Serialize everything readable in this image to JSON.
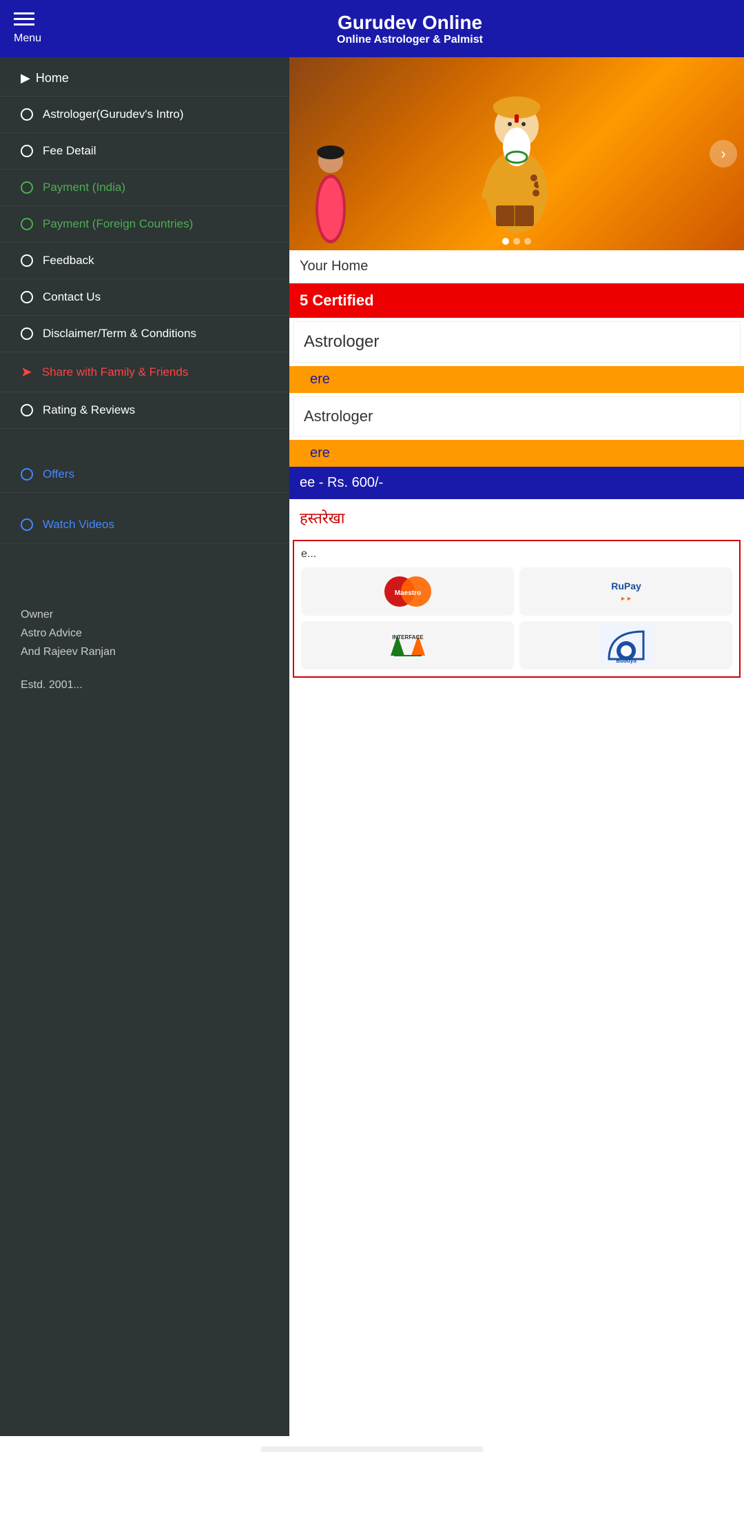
{
  "header": {
    "menu_label": "Menu",
    "app_title": "Gurudev Online",
    "app_subtitle": "Online Astrologer & Palmist"
  },
  "sidebar": {
    "home_label": "Home",
    "items": [
      {
        "id": "astrologer-intro",
        "label": "Astrologer(Gurudev's Intro)",
        "icon": "circle",
        "color": "white"
      },
      {
        "id": "fee-detail",
        "label": "Fee Detail",
        "icon": "circle",
        "color": "white"
      },
      {
        "id": "payment-india",
        "label": "Payment (India)",
        "icon": "circle-green",
        "color": "green"
      },
      {
        "id": "payment-foreign",
        "label": "Payment (Foreign Countries)",
        "icon": "circle-green",
        "color": "green"
      },
      {
        "id": "feedback",
        "label": "Feedback",
        "icon": "circle",
        "color": "white"
      },
      {
        "id": "contact-us",
        "label": "Contact Us",
        "icon": "circle",
        "color": "white"
      },
      {
        "id": "disclaimer",
        "label": "Disclaimer/Term & Conditions",
        "icon": "circle",
        "color": "white"
      },
      {
        "id": "share",
        "label": "Share with Family & Friends",
        "icon": "arrow",
        "color": "red"
      },
      {
        "id": "rating",
        "label": "Rating & Reviews",
        "icon": "circle",
        "color": "white"
      },
      {
        "id": "offers",
        "label": "Offers",
        "icon": "circle-blue",
        "color": "blue"
      },
      {
        "id": "watch-videos",
        "label": "Watch Videos",
        "icon": "circle-blue",
        "color": "blue"
      }
    ],
    "footer": {
      "owner_label": "Owner",
      "owner_name1": "Astro Advice",
      "owner_name2": "And Rajeev Ranjan",
      "estd": "Estd. 2001..."
    }
  },
  "main": {
    "hero_dots": [
      "active",
      "inactive",
      "inactive"
    ],
    "your_home": "Your Home",
    "certified_banner": "5 Certified",
    "astrologer_card1": {
      "title": "Astrologer"
    },
    "visit_here1": "ere",
    "astrologer_card2": {
      "title": "Astrologer"
    },
    "visit_here2": "ere",
    "fee_banner": "ee - Rs. 600/-",
    "hindi_text": "हस्तरेखा",
    "payment_label": "e...",
    "payment_methods": [
      "Maestro",
      "RuPay",
      "UPI Interface",
      "Buddya"
    ]
  },
  "colors": {
    "header_bg": "#1a1aaa",
    "sidebar_bg": "#2d3535",
    "certified_bg": "#cc0000",
    "orange": "#ff9900",
    "fee_bg": "#1a1aaa"
  }
}
